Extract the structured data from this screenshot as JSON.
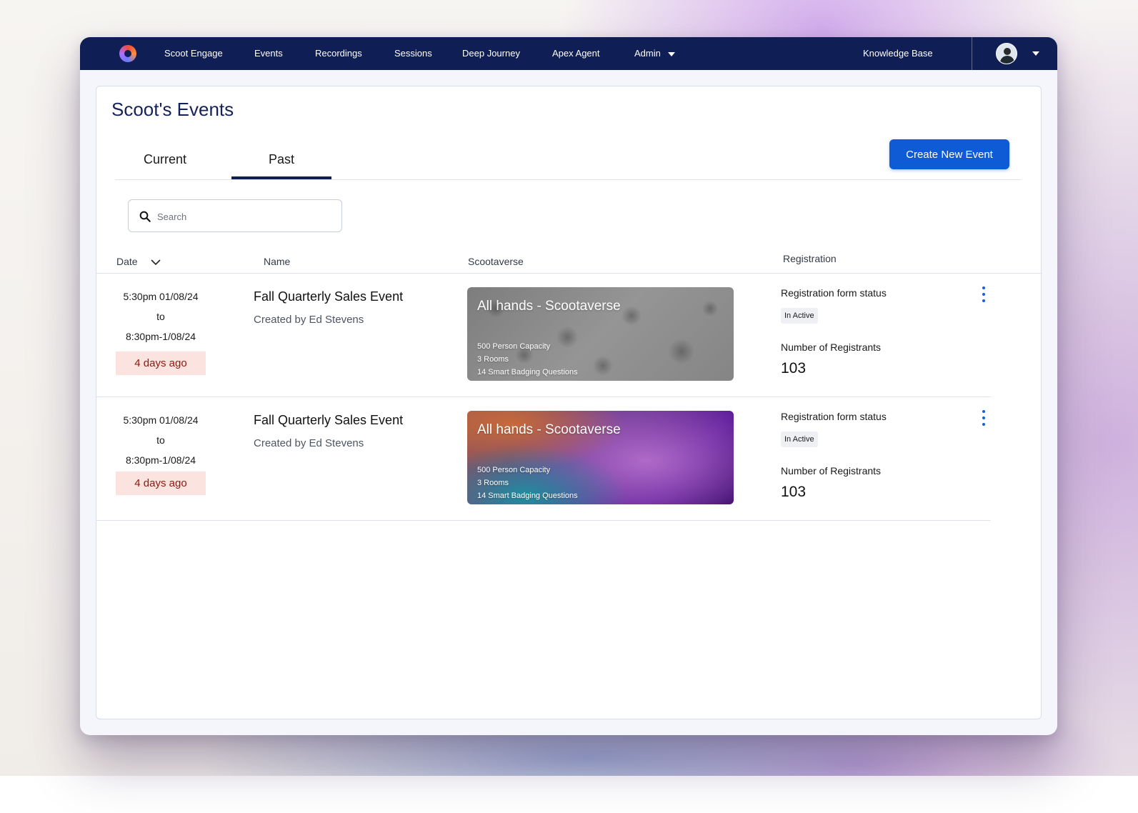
{
  "nav": {
    "items": [
      "Scoot Engage",
      "Events",
      "Recordings",
      "Sessions",
      "Deep Journey",
      "Apex Agent",
      "Admin"
    ],
    "knowledge_base": "Knowledge Base",
    "logo_icon": "scoot-logo-icon",
    "avatar_icon": "user-avatar-icon",
    "background_color": "#0f1e55"
  },
  "page": {
    "title": "Scoot's Events",
    "tabs": [
      {
        "label": "Current",
        "active": false
      },
      {
        "label": "Past",
        "active": true
      }
    ],
    "create_button": "Create New Event",
    "search_placeholder": "Search"
  },
  "table": {
    "columns": {
      "date": "Date",
      "name": "Name",
      "scootaverse": "Scootaverse",
      "registration": "Registration"
    },
    "rows": [
      {
        "start": "5:30pm 01/08/24",
        "to": "to",
        "end": "8:30pm-1/08/24",
        "ago": "4 days ago",
        "name": "Fall Quarterly Sales Event",
        "created_by": "Created by Ed Stevens",
        "verse_title": "All hands - Scootaverse",
        "verse_capacity": "500 Person Capacity",
        "verse_rooms": "3 Rooms",
        "verse_questions": "14 Smart Badging Questions",
        "reg_status_label": "Registration form status",
        "reg_status": "In Active",
        "reg_count_label": "Number of Registrants",
        "reg_count": "103"
      },
      {
        "start": "5:30pm 01/08/24",
        "to": "to",
        "end": "8:30pm-1/08/24",
        "ago": "4 days ago",
        "name": "Fall Quarterly Sales Event",
        "created_by": "Created by Ed Stevens",
        "verse_title": "All hands - Scootaverse",
        "verse_capacity": "500 Person Capacity",
        "verse_rooms": "3 Rooms",
        "verse_questions": "14 Smart Badging Questions",
        "reg_status_label": "Registration form status",
        "reg_status": "In Active",
        "reg_count_label": "Number of Registrants",
        "reg_count": "103"
      }
    ]
  },
  "colors": {
    "primary_button": "#0f5bd6",
    "ago_badge_bg": "#fbe3df",
    "ago_badge_text": "#8a1a12",
    "kebab": "#1463d6"
  }
}
